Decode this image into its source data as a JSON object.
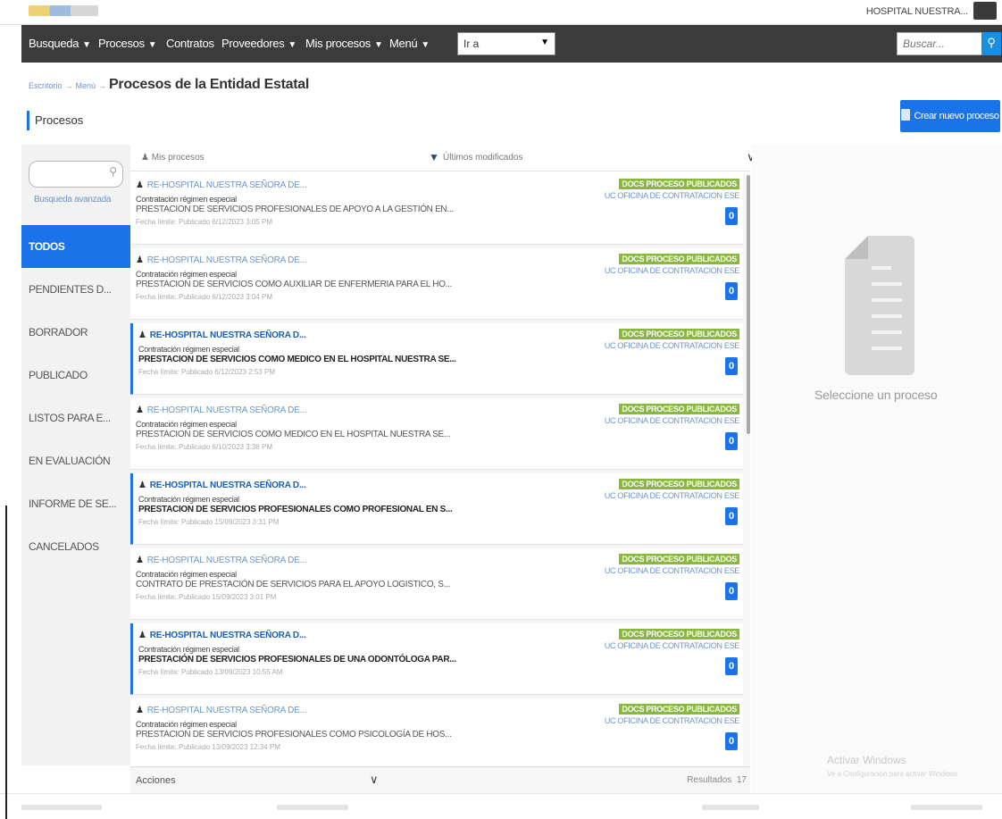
{
  "banner": {
    "user": "HOSPITAL NUESTRA..."
  },
  "nav": {
    "items": [
      "Busqueda",
      "Procesos",
      "Contratos",
      "Proveedores",
      "Mis procesos",
      "Menú"
    ],
    "carets": [
      true,
      true,
      false,
      true,
      true,
      true
    ],
    "goto_value": "Ir a",
    "search_placeholder": "Buscar..."
  },
  "breadcrumb": {
    "crumbs": [
      "Escritorio",
      "Menú"
    ],
    "title": "Procesos de la Entidad Estatal"
  },
  "section_label": "Procesos",
  "create_button": "Crear nuevo proceso",
  "sidebar": {
    "advanced_search": "Busqueda avanzada",
    "filters": [
      "TODOS",
      "PENDIENTES D...",
      "BORRADOR",
      "PUBLICADO",
      "LISTOS PARA E...",
      "EN EVALUACIÓN",
      "INFORME DE SE...",
      "CANCELADOS"
    ],
    "active_filter": "TODOS"
  },
  "list_header": {
    "owner_filter": "Mis procesos",
    "sort": "Últimos modificados"
  },
  "processes": [
    {
      "entity": "RE-HOSPITAL NUESTRA SEÑORA DE...",
      "modality": "Contratación régimen especial",
      "description": "PRESTACION DE SERVICIOS PROFESIONALES DE APOYO A LA GESTIÓN EN...",
      "dates": "Fecha límite:   Publicado 6/12/2023 3:05 PM",
      "status": "DOCS PROCESO PUBLICADOS",
      "unit": "UC OFICINA DE CONTRATACION ESE",
      "count": "0",
      "unread": false
    },
    {
      "entity": "RE-HOSPITAL NUESTRA SEÑORA DE...",
      "modality": "Contratación régimen especial",
      "description": "PRESTACION DE SERVICIOS COMO AUXILIAR DE ENFERMERIA PARA EL HO...",
      "dates": "Fecha límite:   Publicado 6/12/2023 3:04 PM",
      "status": "DOCS PROCESO PUBLICADOS",
      "unit": "UC OFICINA DE CONTRATACION ESE",
      "count": "0",
      "unread": false
    },
    {
      "entity": "RE-HOSPITAL NUESTRA SEÑORA D...",
      "modality": "Contratación régimen especial",
      "description": "PRESTACION DE SERVICIOS COMO MEDICO EN EL HOSPITAL NUESTRA SE...",
      "dates": "Fecha límite:   Publicado 6/12/2023 2:53 PM",
      "status": "DOCS PROCESO PUBLICADOS",
      "unit": "UC OFICINA DE CONTRATACION ESE",
      "count": "0",
      "unread": true
    },
    {
      "entity": "RE-HOSPITAL NUESTRA SEÑORA DE...",
      "modality": "Contratación régimen especial",
      "description": "PRESTACION DE SERVICIOS COMO MEDICO EN EL HOSPITAL NUESTRA SE...",
      "dates": "Fecha límite:   Publicado 6/10/2023 3:38 PM",
      "status": "DOCS PROCESO PUBLICADOS",
      "unit": "UC OFICINA DE CONTRATACION ESE",
      "count": "0",
      "unread": false
    },
    {
      "entity": "RE-HOSPITAL NUESTRA SEÑORA D...",
      "modality": "Contratación régimen especial",
      "description": "PRESTACION DE SERVICIOS PROFESIONALES COMO PROFESIONAL EN S...",
      "dates": "Fecha límite:   Publicado 15/09/2023 3:31 PM",
      "status": "DOCS PROCESO PUBLICADOS",
      "unit": "UC OFICINA DE CONTRATACION ESE",
      "count": "0",
      "unread": true
    },
    {
      "entity": "RE-HOSPITAL NUESTRA SEÑORA DE...",
      "modality": "Contratación régimen especial",
      "description": "CONTRATO DE PRESTACIÓN DE SERVICIOS PARA EL APOYO LOGISTICO, S...",
      "dates": "Fecha límite:   Publicado 15/09/2023 3:01 PM",
      "status": "DOCS PROCESO PUBLICADOS",
      "unit": "UC OFICINA DE CONTRATACION ESE",
      "count": "0",
      "unread": false
    },
    {
      "entity": "RE-HOSPITAL NUESTRA SEÑORA D...",
      "modality": "Contratación régimen especial",
      "description": "PRESTACIÓN DE SERVICIOS PROFESIONALES DE UNA ODONTÓLOGA PAR...",
      "dates": "Fecha límite:   Publicado 13/09/2023 10:55 AM",
      "status": "DOCS PROCESO PUBLICADOS",
      "unit": "UC OFICINA DE CONTRATACION ESE",
      "count": "0",
      "unread": true
    },
    {
      "entity": "RE-HOSPITAL NUESTRA SEÑORA DE...",
      "modality": "Contratación régimen especial",
      "description": "PRESTACION DE SERVICIOS PROFESIONALES COMO PSICOLOGÍA DE HOS...",
      "dates": "Fecha límite:   Publicado 13/09/2023 12:34 PM",
      "status": "DOCS PROCESO PUBLICADOS",
      "unit": "UC OFICINA DE CONTRATACION ESE",
      "count": "0",
      "unread": false
    }
  ],
  "list_footer": {
    "actions": "Acciones",
    "results_label": "Resultados",
    "results_count": "17"
  },
  "detail": {
    "empty_hint": "Seleccione un proceso"
  },
  "watermark": {
    "title": "Activar Windows",
    "subtitle": "Ve a Configuración para activar Windows."
  },
  "colors": {
    "nav_bg": "#3b3b3b",
    "accent": "#1a73e8",
    "status": "#8ab83f",
    "link": "#6a94c9"
  },
  "icons": {
    "user": "person-icon",
    "search": "magnifier-icon",
    "document": "document-icon",
    "chevron": "chevron-down-icon"
  }
}
